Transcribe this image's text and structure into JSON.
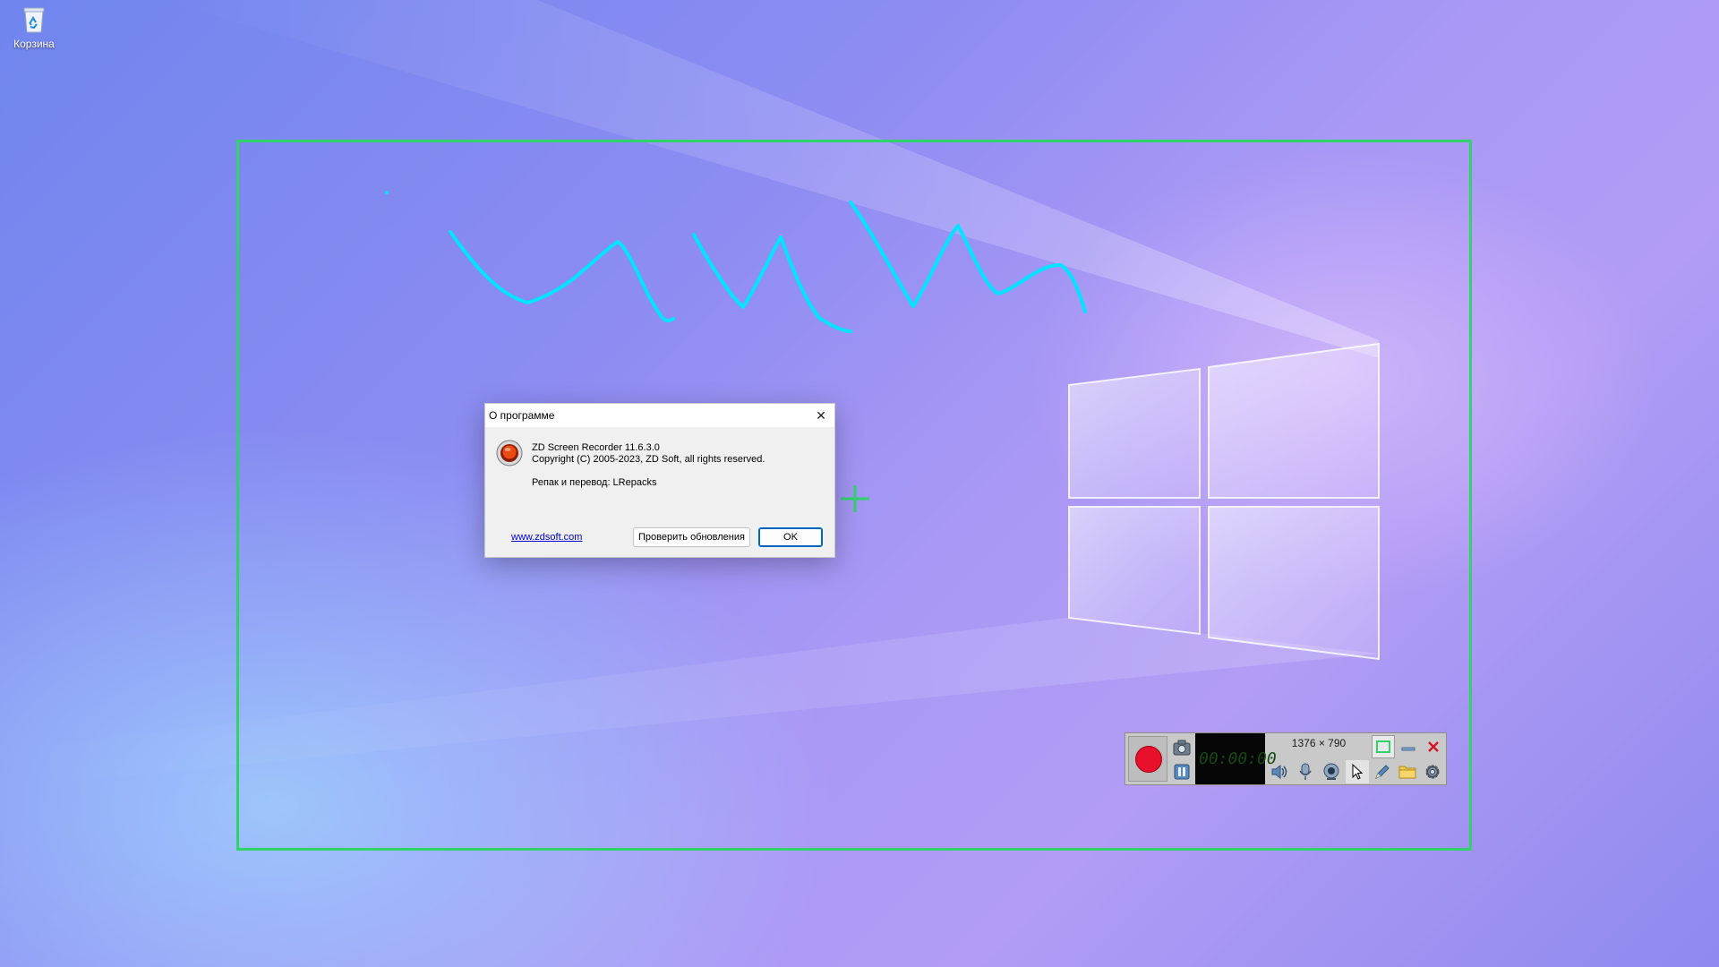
{
  "desktop": {
    "recycle_bin_label": "Корзина"
  },
  "about_dialog": {
    "title": "О программе",
    "app_name_version": "ZD Screen Recorder 11.6.3.0",
    "copyright": "Copyright (C) 2005-2023, ZD Soft, all rights reserved.",
    "repack_credit": "Репак и перевод: LRepacks",
    "website_link": "www.zdsoft.com",
    "check_updates_label": "Проверить обновления",
    "ok_label": "OK",
    "close_symbol": "✕"
  },
  "recorder_toolbar": {
    "timer_display": "00:00:00",
    "resolution": "1376 × 790",
    "icons": [
      "record-icon",
      "camera-icon",
      "pause-icon",
      "speaker-icon",
      "microphone-icon",
      "webcam-icon",
      "cursor-icon",
      "pen-icon",
      "folder-icon",
      "gear-icon",
      "region-icon",
      "minimize-icon",
      "close-icon"
    ]
  },
  "colors": {
    "region_border": "#2fd36a",
    "annotation_stroke": "#00e5ff",
    "record_red": "#e8102a",
    "link_blue": "#0000d0"
  }
}
